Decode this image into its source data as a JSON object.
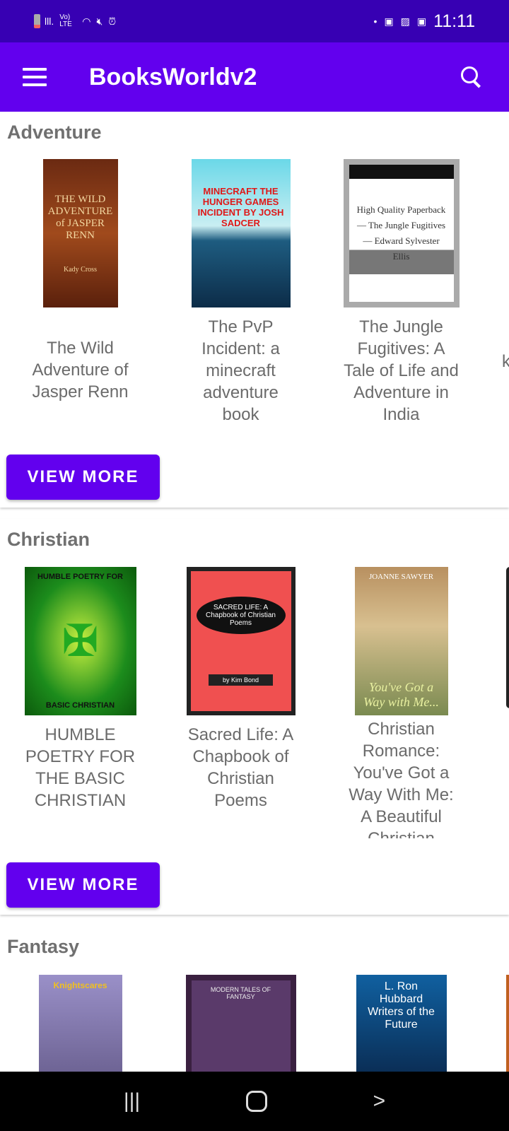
{
  "status_bar": {
    "time": "11:11",
    "left_icons": [
      "battery-icon",
      "signal-icon",
      "volte-icon",
      "wifi-icon",
      "mute-icon",
      "alarm-icon"
    ],
    "right_icons": [
      "dot-icon",
      "outlook-icon",
      "image-icon",
      "outlook-icon"
    ],
    "volte": "Vo) LTE"
  },
  "app_bar": {
    "title": "BooksWorldv2",
    "bg": "#6200ee",
    "status_bg": "#3700b3"
  },
  "sections": [
    {
      "title": "Adventure",
      "button": "VIEW MORE",
      "books": [
        {
          "title": "The Wild Adventure of Jasper Renn",
          "cover_text": "THE WILD ADVENTURE OF JASPER RENN — Kady Cross"
        },
        {
          "title": "The PvP Incident: a minecraft adventure book",
          "cover_text": "MINECRAFT THE HUNGER GAMES INCIDENT BY JOSH SADCER"
        },
        {
          "title": "The Jungle Fugitives: A Tale of Life and Adventure in India",
          "cover_text": "High Quality Paperback — The Jungle Fugitives — Edward Sylvester Ellis"
        }
      ],
      "partial": "k"
    },
    {
      "title": "Christian",
      "button": "VIEW MORE",
      "books": [
        {
          "title": "HUMBLE POETRY FOR THE BASIC CHRISTIAN",
          "cover_text": "HUMBLE POETRY FOR THE BASIC CHRISTIAN"
        },
        {
          "title": "Sacred Life: A Chapbook of Christian Poems",
          "cover_text": "SACRED LIFE: A Chapbook of Christian Poems — by Kim Bond"
        },
        {
          "title": "Christian Romance: You've Got a Way With Me: A Beautiful Christian",
          "cover_text": "JOANNE SAWYER — You've Got a Way with Me..."
        }
      ]
    },
    {
      "title": "Fantasy",
      "books": [
        {
          "cover_text": "Knightscares"
        },
        {
          "cover_text": "MODERN TALES OF FANTASY"
        },
        {
          "cover_text": "L. Ron Hubbard Writers of the Future"
        }
      ]
    }
  ]
}
